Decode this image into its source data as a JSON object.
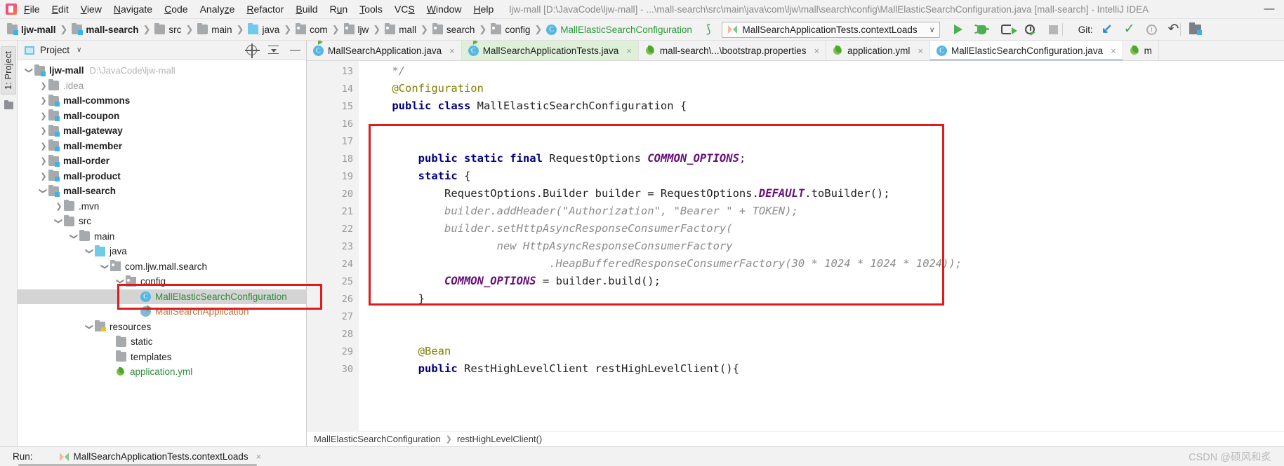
{
  "window": {
    "title": "ljw-mall [D:\\JavaCode\\ljw-mall] - ...\\mall-search\\src\\main\\java\\com\\ljw\\mall\\search\\config\\MallElasticSearchConfiguration.java [mall-search] - IntelliJ IDEA",
    "minimize_label": "—"
  },
  "menu": [
    {
      "label": "File",
      "mnemonic": "F"
    },
    {
      "label": "Edit",
      "mnemonic": "E"
    },
    {
      "label": "View",
      "mnemonic": "V"
    },
    {
      "label": "Navigate",
      "mnemonic": "N"
    },
    {
      "label": "Code",
      "mnemonic": "C"
    },
    {
      "label": "Analyze",
      "mnemonic": "z"
    },
    {
      "label": "Refactor",
      "mnemonic": "R"
    },
    {
      "label": "Build",
      "mnemonic": "B"
    },
    {
      "label": "Run",
      "mnemonic": "u"
    },
    {
      "label": "Tools",
      "mnemonic": "T"
    },
    {
      "label": "VCS",
      "mnemonic": "S"
    },
    {
      "label": "Window",
      "mnemonic": "W"
    },
    {
      "label": "Help",
      "mnemonic": "H"
    }
  ],
  "navbar": {
    "crumbs": [
      {
        "label": "ljw-mall",
        "icon": "module-folder-icon",
        "style": "bold"
      },
      {
        "label": "mall-search",
        "icon": "module-folder-icon",
        "style": "bold"
      },
      {
        "label": "src",
        "icon": "folder-icon",
        "style": "plain"
      },
      {
        "label": "main",
        "icon": "folder-icon",
        "style": "plain"
      },
      {
        "label": "java",
        "icon": "source-folder-icon",
        "style": "plain"
      },
      {
        "label": "com",
        "icon": "package-icon",
        "style": "plain"
      },
      {
        "label": "ljw",
        "icon": "package-icon",
        "style": "plain"
      },
      {
        "label": "mall",
        "icon": "package-icon",
        "style": "plain"
      },
      {
        "label": "search",
        "icon": "package-icon",
        "style": "plain"
      },
      {
        "label": "config",
        "icon": "package-icon",
        "style": "plain"
      },
      {
        "label": "MallElasticSearchConfiguration",
        "icon": "java-class-icon",
        "style": "green"
      }
    ],
    "separator": "❯",
    "run_config": {
      "name": "MallSearchApplicationTests.contextLoads",
      "caret": "∨"
    },
    "toolbar": [
      {
        "name": "run-button",
        "icon": "run-icon"
      },
      {
        "name": "debug-button",
        "icon": "debug-bug-icon"
      },
      {
        "name": "run-with-coverage-button",
        "icon": "coverage-icon"
      },
      {
        "name": "profile-button",
        "icon": "profiler-icon"
      },
      {
        "name": "stop-button",
        "icon": "stop-icon"
      }
    ],
    "git_label": "Git:",
    "git_toolbar": [
      {
        "name": "update-project-button",
        "icon": "arrow-down-left-icon",
        "glyph": "↙"
      },
      {
        "name": "commit-button",
        "icon": "checkmark-icon",
        "glyph": "✓"
      },
      {
        "name": "history-button",
        "icon": "clock-icon"
      },
      {
        "name": "rollback-button",
        "icon": "undo-arrow-icon",
        "glyph": "↶"
      }
    ]
  },
  "project_panel": {
    "rail_tab": "1: Project",
    "title": "Project",
    "caret": "∨",
    "actions": [
      {
        "name": "select-opened-file-icon"
      },
      {
        "name": "collapse-all-icon"
      },
      {
        "name": "hide-panel-icon",
        "glyph": "—"
      }
    ],
    "tree": [
      {
        "label": "ljw-mall",
        "path": "D:\\JavaCode\\ljw-mall",
        "indent": 0,
        "twisty": "open",
        "icon": "module-folder-icon",
        "style": "bold"
      },
      {
        "label": ".idea",
        "indent": 1,
        "twisty": "closed",
        "icon": "folder-icon",
        "style": "muted"
      },
      {
        "label": "mall-commons",
        "indent": 1,
        "twisty": "closed",
        "icon": "module-folder-icon",
        "style": "bold"
      },
      {
        "label": "mall-coupon",
        "indent": 1,
        "twisty": "closed",
        "icon": "module-folder-icon",
        "style": "bold"
      },
      {
        "label": "mall-gateway",
        "indent": 1,
        "twisty": "closed",
        "icon": "module-folder-icon",
        "style": "bold"
      },
      {
        "label": "mall-member",
        "indent": 1,
        "twisty": "closed",
        "icon": "module-folder-icon",
        "style": "bold"
      },
      {
        "label": "mall-order",
        "indent": 1,
        "twisty": "closed",
        "icon": "module-folder-icon",
        "style": "bold"
      },
      {
        "label": "mall-product",
        "indent": 1,
        "twisty": "closed",
        "icon": "module-folder-icon",
        "style": "bold"
      },
      {
        "label": "mall-search",
        "indent": 1,
        "twisty": "open",
        "icon": "module-folder-icon",
        "style": "bold"
      },
      {
        "label": ".mvn",
        "indent": 2,
        "twisty": "closed",
        "icon": "folder-icon",
        "style": "plain"
      },
      {
        "label": "src",
        "indent": 2,
        "twisty": "open",
        "icon": "folder-icon",
        "style": "plain"
      },
      {
        "label": "main",
        "indent": 3,
        "twisty": "open",
        "icon": "folder-icon",
        "style": "plain"
      },
      {
        "label": "java",
        "indent": 4,
        "twisty": "open",
        "icon": "source-folder-icon",
        "style": "plain"
      },
      {
        "label": "com.ljw.mall.search",
        "indent": 5,
        "twisty": "open",
        "icon": "package-icon",
        "style": "plain"
      },
      {
        "label": "config",
        "indent": 6,
        "twisty": "open",
        "icon": "package-icon",
        "style": "plain"
      },
      {
        "label": "MallElasticSearchConfiguration",
        "indent": 7,
        "twisty": "none",
        "icon": "java-class-icon",
        "style": "green",
        "selected": true
      },
      {
        "label": "MallSearchApplication",
        "indent": 7,
        "twisty": "none",
        "icon": "spring-app-icon",
        "style": "orange"
      },
      {
        "label": "resources",
        "indent": 4,
        "twisty": "open",
        "icon": "resources-folder-icon",
        "style": "plain"
      },
      {
        "label": "static",
        "indent": 5,
        "twisty": "none",
        "icon": "folder-icon",
        "style": "plain"
      },
      {
        "label": "templates",
        "indent": 5,
        "twisty": "none",
        "icon": "folder-icon",
        "style": "plain"
      },
      {
        "label": "application.yml",
        "indent": 5,
        "twisty": "none",
        "icon": "yaml-file-icon",
        "style": "plain"
      }
    ]
  },
  "editor": {
    "tabs": [
      {
        "label": "MallSearchApplication.java",
        "icon": "java-runnable-class-icon",
        "state": "normal",
        "close": "×"
      },
      {
        "label": "MallSearchApplicationTests.java",
        "icon": "java-runnable-class-icon",
        "state": "modified",
        "close": "×"
      },
      {
        "label": "mall-search\\...\\bootstrap.properties",
        "icon": "properties-file-icon",
        "state": "normal",
        "close": "×"
      },
      {
        "label": "application.yml",
        "icon": "yaml-file-icon",
        "state": "normal",
        "close": "×"
      },
      {
        "label": "MallElasticSearchConfiguration.java",
        "icon": "java-class-icon",
        "state": "active",
        "close": "×"
      },
      {
        "label": "m",
        "icon": "yaml-file-icon",
        "state": "normal",
        "close": ""
      }
    ],
    "first_line_number": 13,
    "lines": [
      {
        "num": "13",
        "tokens": [
          {
            "t": "    */",
            "c": "plain"
          }
        ],
        "fold": "end"
      },
      {
        "num": "14",
        "tokens": [
          {
            "t": "    @Configuration",
            "c": "ann"
          }
        ]
      },
      {
        "num": "15",
        "tokens": [
          {
            "t": "    ",
            "c": "plain"
          },
          {
            "t": "public class",
            "c": "kw"
          },
          {
            "t": " MallElasticSearchConfiguration {",
            "c": "plain"
          }
        ],
        "gutter_icon": "spring-bean-icon"
      },
      {
        "num": "16",
        "tokens": []
      },
      {
        "num": "17",
        "tokens": []
      },
      {
        "num": "18",
        "tokens": [
          {
            "t": "        ",
            "c": "plain"
          },
          {
            "t": "public static final",
            "c": "kw"
          },
          {
            "t": " RequestOptions ",
            "c": "plain"
          },
          {
            "t": "COMMON_OPTIONS",
            "c": "fld"
          },
          {
            "t": ";",
            "c": "plain"
          }
        ]
      },
      {
        "num": "19",
        "tokens": [
          {
            "t": "        ",
            "c": "plain"
          },
          {
            "t": "static",
            "c": "kw"
          },
          {
            "t": " {",
            "c": "plain"
          }
        ],
        "fold": "open"
      },
      {
        "num": "20",
        "tokens": [
          {
            "t": "            RequestOptions.Builder builder = RequestOptions.",
            "c": "plain"
          },
          {
            "t": "DEFAULT",
            "c": "fld"
          },
          {
            "t": ".toBuilder();",
            "c": "plain"
          }
        ]
      },
      {
        "num": "21",
        "tokens": [
          {
            "t": "//",
            "c": "cmt-marker"
          },
          {
            "t": "            builder.addHeader(\"Authorization\", \"Bearer \" + TOKEN);",
            "c": "cmt"
          }
        ],
        "fold": "open"
      },
      {
        "num": "22",
        "tokens": [
          {
            "t": "//",
            "c": "cmt-marker"
          },
          {
            "t": "            builder.setHttpAsyncResponseConsumerFactory(",
            "c": "cmt"
          }
        ]
      },
      {
        "num": "23",
        "tokens": [
          {
            "t": "//",
            "c": "cmt-marker"
          },
          {
            "t": "                    new HttpAsyncResponseConsumerFactory",
            "c": "cmt"
          }
        ]
      },
      {
        "num": "24",
        "tokens": [
          {
            "t": "//",
            "c": "cmt-marker"
          },
          {
            "t": "                            .HeapBufferedResponseConsumerFactory(30 * 1024 * 1024 * 1024));",
            "c": "cmt"
          }
        ],
        "fold": "end"
      },
      {
        "num": "25",
        "tokens": [
          {
            "t": "            ",
            "c": "plain"
          },
          {
            "t": "COMMON_OPTIONS",
            "c": "fld"
          },
          {
            "t": " = builder.build();",
            "c": "plain"
          }
        ]
      },
      {
        "num": "26",
        "tokens": [
          {
            "t": "        }",
            "c": "plain"
          }
        ],
        "fold": "end"
      },
      {
        "num": "27",
        "tokens": []
      },
      {
        "num": "28",
        "tokens": []
      },
      {
        "num": "29",
        "tokens": [
          {
            "t": "        @Bean",
            "c": "ann"
          }
        ],
        "gutter_icon": "bean-icon"
      },
      {
        "num": "30",
        "tokens": [
          {
            "t": "        ",
            "c": "plain"
          },
          {
            "t": "public",
            "c": "kw"
          },
          {
            "t": " RestHighLevelClient restHighLevelClient(){",
            "c": "plain"
          }
        ]
      }
    ],
    "breadcrumb": [
      "MallElasticSearchConfiguration",
      "restHighLevelClient()"
    ],
    "breadcrumb_separator": "❯"
  },
  "statusbar": {
    "run_label": "Run:",
    "run_tab": "MallSearchApplicationTests.contextLoads",
    "run_tab_close": "×",
    "watermark": "CSDN @硕风和炙"
  },
  "colors": {
    "accent_blue": "#3f8ddb",
    "annotation_red": "#e01b1b",
    "green_text": "#2f8c3b",
    "modified_tab": "#dff0d8"
  }
}
